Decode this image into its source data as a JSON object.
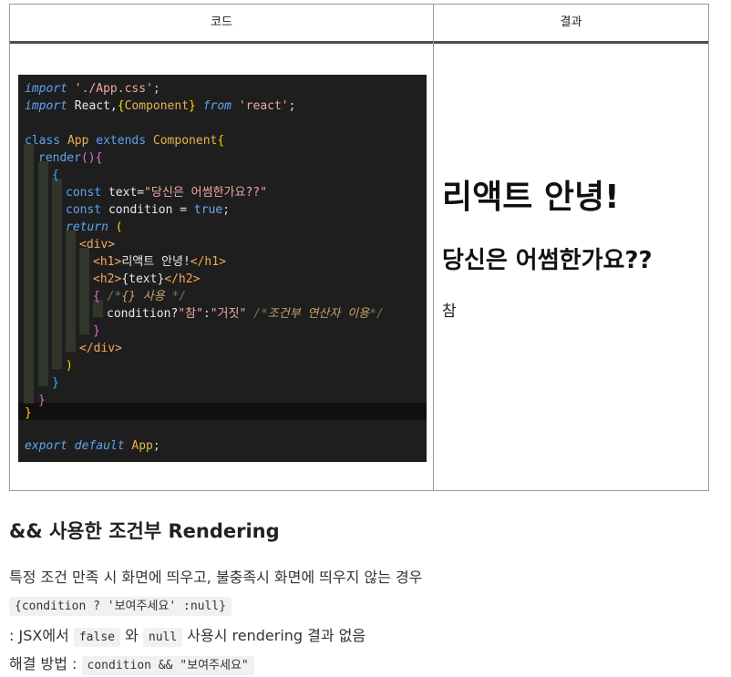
{
  "table": {
    "header_code": "코드",
    "header_result": "결과"
  },
  "code_lines": [
    "import './App.css';",
    "import React,{Component} from 'react';",
    "",
    "class App extends Component{",
    "render(){",
    "{",
    "const text=\"당신은 어썸한가요??\"",
    "const condition = true;",
    "return (",
    "<div>",
    "<h1>리액트 안녕!</h1>",
    "<h2>{text}</h2>",
    "{ /*{} 사용 */",
    "condition?\"참\":\"거짓\" /*조건부 연산자 이용*/",
    "}",
    "</div>",
    ")",
    "}",
    "}",
    "}",
    "",
    "export default App;"
  ],
  "result": {
    "h1": "리액트 안녕!",
    "h2": "당신은 어썸한가요??",
    "p": "참"
  },
  "section": {
    "title": "&& 사용한 조건부 Rendering",
    "line1": "특정 조건 만족 시 화면에 띄우고, 불충족시 화면에 띄우지 않는 경우",
    "code1": "{condition ? '보여주세요' :null}",
    "line3_prefix": ": JSX에서 ",
    "code_false": "false",
    "line3_mid": " 와 ",
    "code_null": "null",
    "line3_suffix": " 사용시 rendering 결과 없음",
    "line4_prefix": "해결 방법 : ",
    "code2": "condition && \"보여주세요\""
  },
  "colors": {
    "editor_bg": "#1e1e1e",
    "keyword": "#5ea3f0",
    "string": "#f2a7a0",
    "class_name": "#e6b450",
    "tag": "#f6a85a",
    "comment": "#6a7a5a"
  }
}
